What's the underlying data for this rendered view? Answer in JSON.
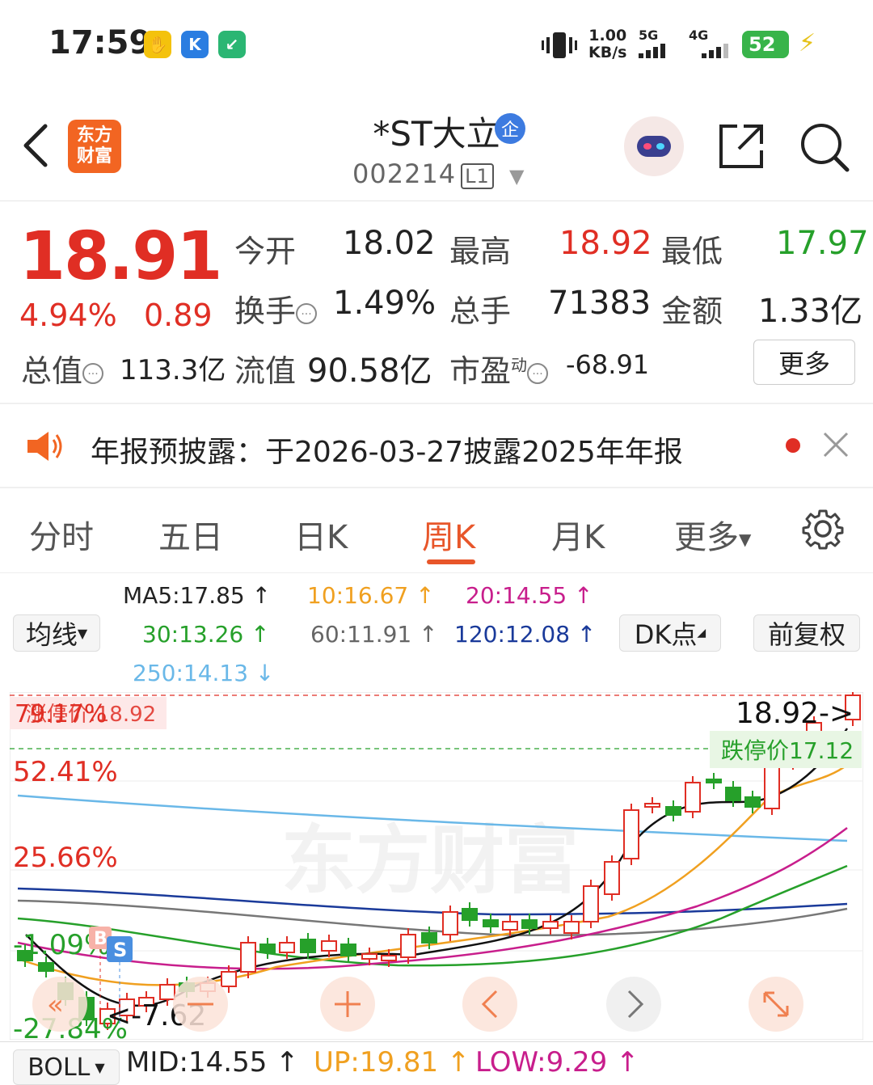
{
  "status_bar": {
    "time": "17:59",
    "net_speed": "1.00",
    "net_unit": "KB/s",
    "sig1": "5G",
    "sig2": "4G",
    "battery": "52"
  },
  "header": {
    "logo_line1": "东方",
    "logo_line2": "财富",
    "stock_name": "*ST大立",
    "badge": "企",
    "code": "002214",
    "level": "L1"
  },
  "quote": {
    "price": "18.91",
    "change_pct": "4.94%",
    "change": "0.89",
    "open_label": "今开",
    "open": "18.02",
    "high_label": "最高",
    "high": "18.92",
    "low_label": "最低",
    "low": "17.97",
    "turnover_label": "换手",
    "turnover": "1.49%",
    "volume_label": "总手",
    "volume": "71383",
    "amount_label": "金额",
    "amount": "1.33亿",
    "mcap_label": "总值",
    "mcap": "113.3亿",
    "float_label": "流值",
    "float": "90.58亿",
    "pe_label": "市盈",
    "pe_sup": "动",
    "pe": "-68.91",
    "more": "更多"
  },
  "notice": {
    "text": "年报预披露：于2026-03-27披露2025年年报"
  },
  "tabs": [
    "分时",
    "五日",
    "日K",
    "周K",
    "月K",
    "更多"
  ],
  "ma": {
    "selector": "均线",
    "ma5": "MA5:17.85 ↑",
    "ma10": "10:16.67 ↑",
    "ma20": "20:14.55 ↑",
    "ma30": "30:13.26 ↑",
    "ma60": "60:11.91 ↑",
    "ma120": "120:12.08 ↑",
    "ma250": "250:14.13 ↓",
    "dk": "DK点",
    "adjust": "前复权"
  },
  "chart_labels": {
    "top_left": "79.17%",
    "top_left_overlay": "涨停价:18.92",
    "y1": "52.41%",
    "y2": "25.66%",
    "y3": "-1.09%",
    "y4": "-27.84%",
    "high_mark": "18.92->",
    "limit_down": "跌停价17.12",
    "low_mark": "<-7.62",
    "b_marker": "B",
    "s_marker": "S",
    "watermark": "东方财富"
  },
  "boll": {
    "selector": "BOLL",
    "mid": "MID:14.55 ↑",
    "up": "UP:19.81 ↑",
    "low": "LOW:9.29 ↑"
  },
  "colors": {
    "up": "#e02e24",
    "down": "#26a02a",
    "accent": "#e8562a"
  }
}
